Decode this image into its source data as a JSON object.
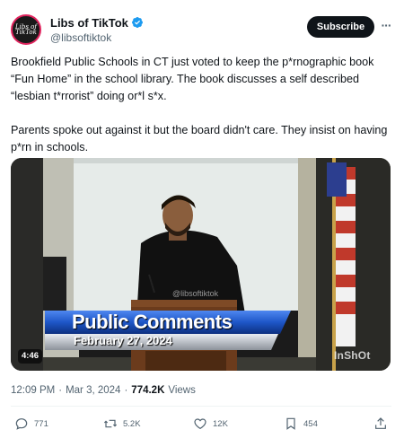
{
  "author": {
    "display_name": "Libs of TikTok",
    "handle": "@libsoftiktok",
    "avatar_text": "Libs of TikTok"
  },
  "header": {
    "subscribe_label": "Subscribe",
    "more_icon": "more-icon"
  },
  "tweet": {
    "paragraph1": "Brookfield Public Schools in CT just voted to keep the p*rnographic book “Fun Home” in the school library. The book discusses a self described “lesbian t*rrorist” doing or*l s*x.",
    "paragraph2": "Parents spoke out against it but the board didn't care. They insist on having p*rn in schools."
  },
  "video": {
    "lower_third_title": "Public Comments",
    "lower_third_date": "February 27, 2024",
    "watermark": "@libsoftiktok",
    "inshot_mark": "InShOt",
    "duration": "4:46"
  },
  "meta": {
    "time": "12:09 PM",
    "separator": "·",
    "date": "Mar 3, 2024",
    "views_count": "774.2K",
    "views_label": "Views"
  },
  "actions": {
    "replies": "771",
    "reposts": "5.2K",
    "likes": "12K",
    "bookmarks": "454"
  },
  "colors": {
    "verified_blue": "#1d9bf0",
    "text_primary": "#0f1419",
    "text_secondary": "#536471",
    "lower_third_blue": "#1e56c8"
  }
}
